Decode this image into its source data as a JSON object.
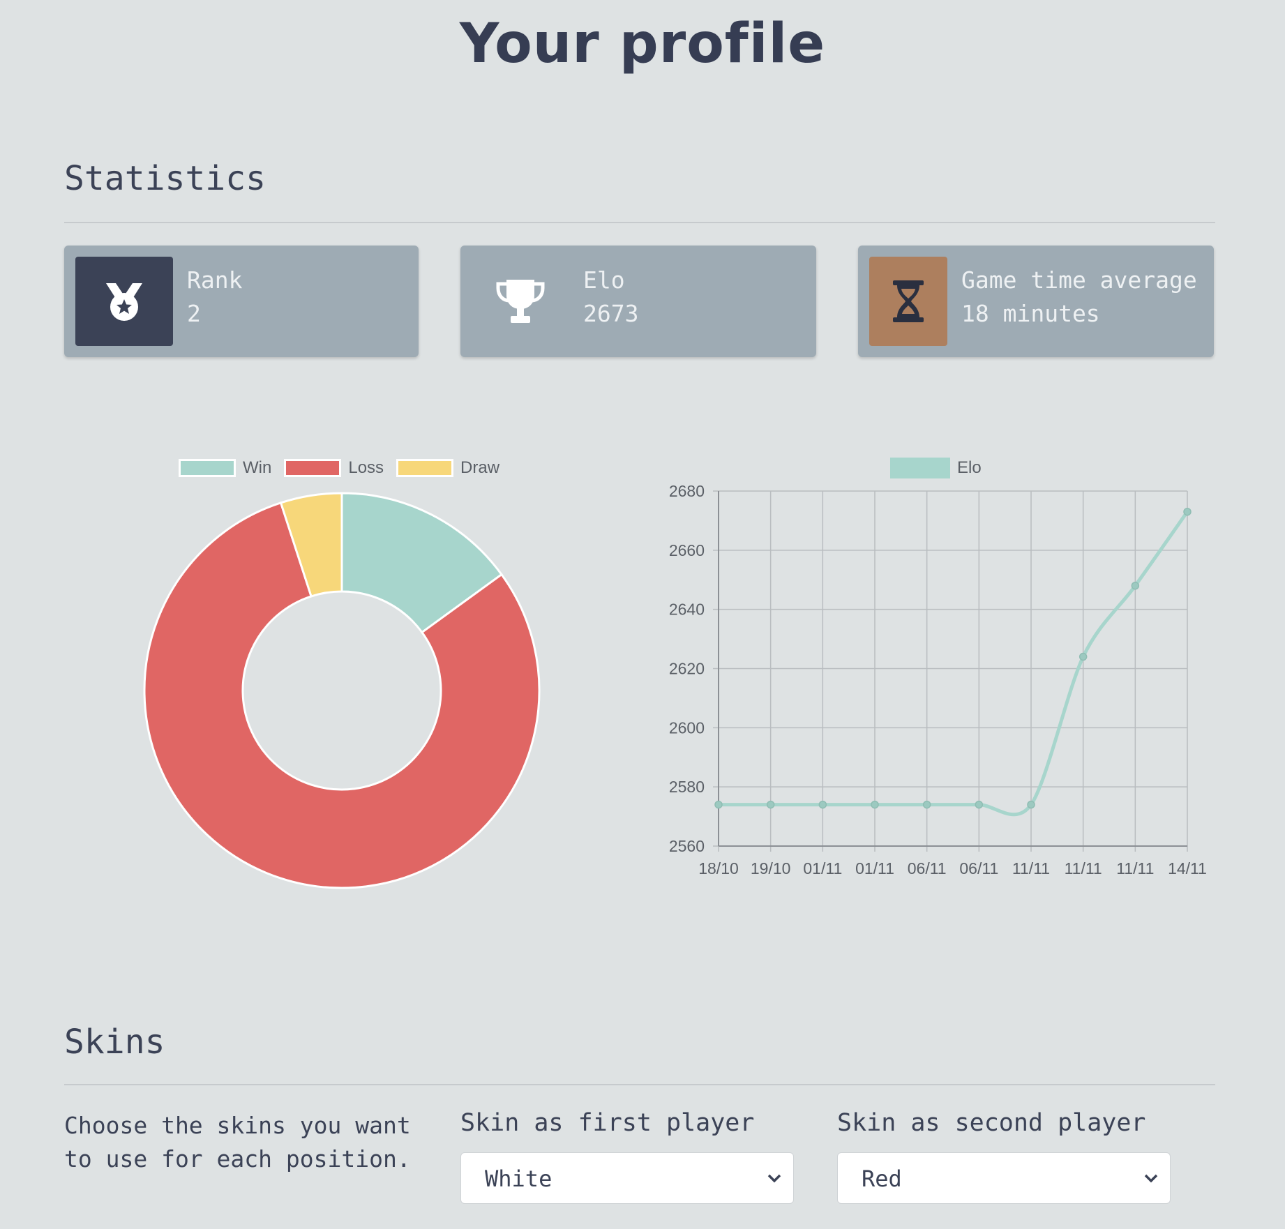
{
  "page": {
    "title": "Your profile"
  },
  "statistics": {
    "heading": "Statistics",
    "cards": [
      {
        "label": "Rank",
        "value": "2",
        "icon": "medal-icon",
        "icon_bg": "#3b4256"
      },
      {
        "label": "Elo",
        "value": "2673",
        "icon": "trophy-icon",
        "icon_bg": "#9eabb4"
      },
      {
        "label": "Game time average",
        "value": "18 minutes",
        "icon": "hourglass-icon",
        "icon_bg": "#ad7f5e"
      }
    ]
  },
  "chart_data": [
    {
      "type": "pie",
      "variant": "doughnut",
      "title": "",
      "categories": [
        "Win",
        "Loss",
        "Draw"
      ],
      "values": [
        15,
        80,
        5
      ],
      "colors": [
        "#a7d5cc",
        "#e06664",
        "#f7d77a"
      ],
      "legend": "top"
    },
    {
      "type": "line",
      "title": "",
      "series": [
        {
          "name": "Elo",
          "color": "#a7d5cc",
          "values": [
            2574,
            2574,
            2574,
            2574,
            2574,
            2574,
            2574,
            2624,
            2648,
            2673
          ]
        }
      ],
      "categories": [
        "18/10",
        "19/10",
        "01/11",
        "01/11",
        "06/11",
        "06/11",
        "11/11",
        "11/11",
        "11/11",
        "14/11"
      ],
      "ylim": [
        2560,
        2680
      ],
      "yticks": [
        "2560",
        "2580",
        "2600",
        "2620",
        "2640",
        "2660",
        "2680"
      ],
      "xlabel": "",
      "ylabel": "",
      "grid": true,
      "legend": "top"
    }
  ],
  "skins": {
    "heading": "Skins",
    "description": "Choose the skins you want to use for each position.",
    "first_label": "Skin as first player",
    "first_value": "White",
    "second_label": "Skin as second player",
    "second_value": "Red"
  }
}
